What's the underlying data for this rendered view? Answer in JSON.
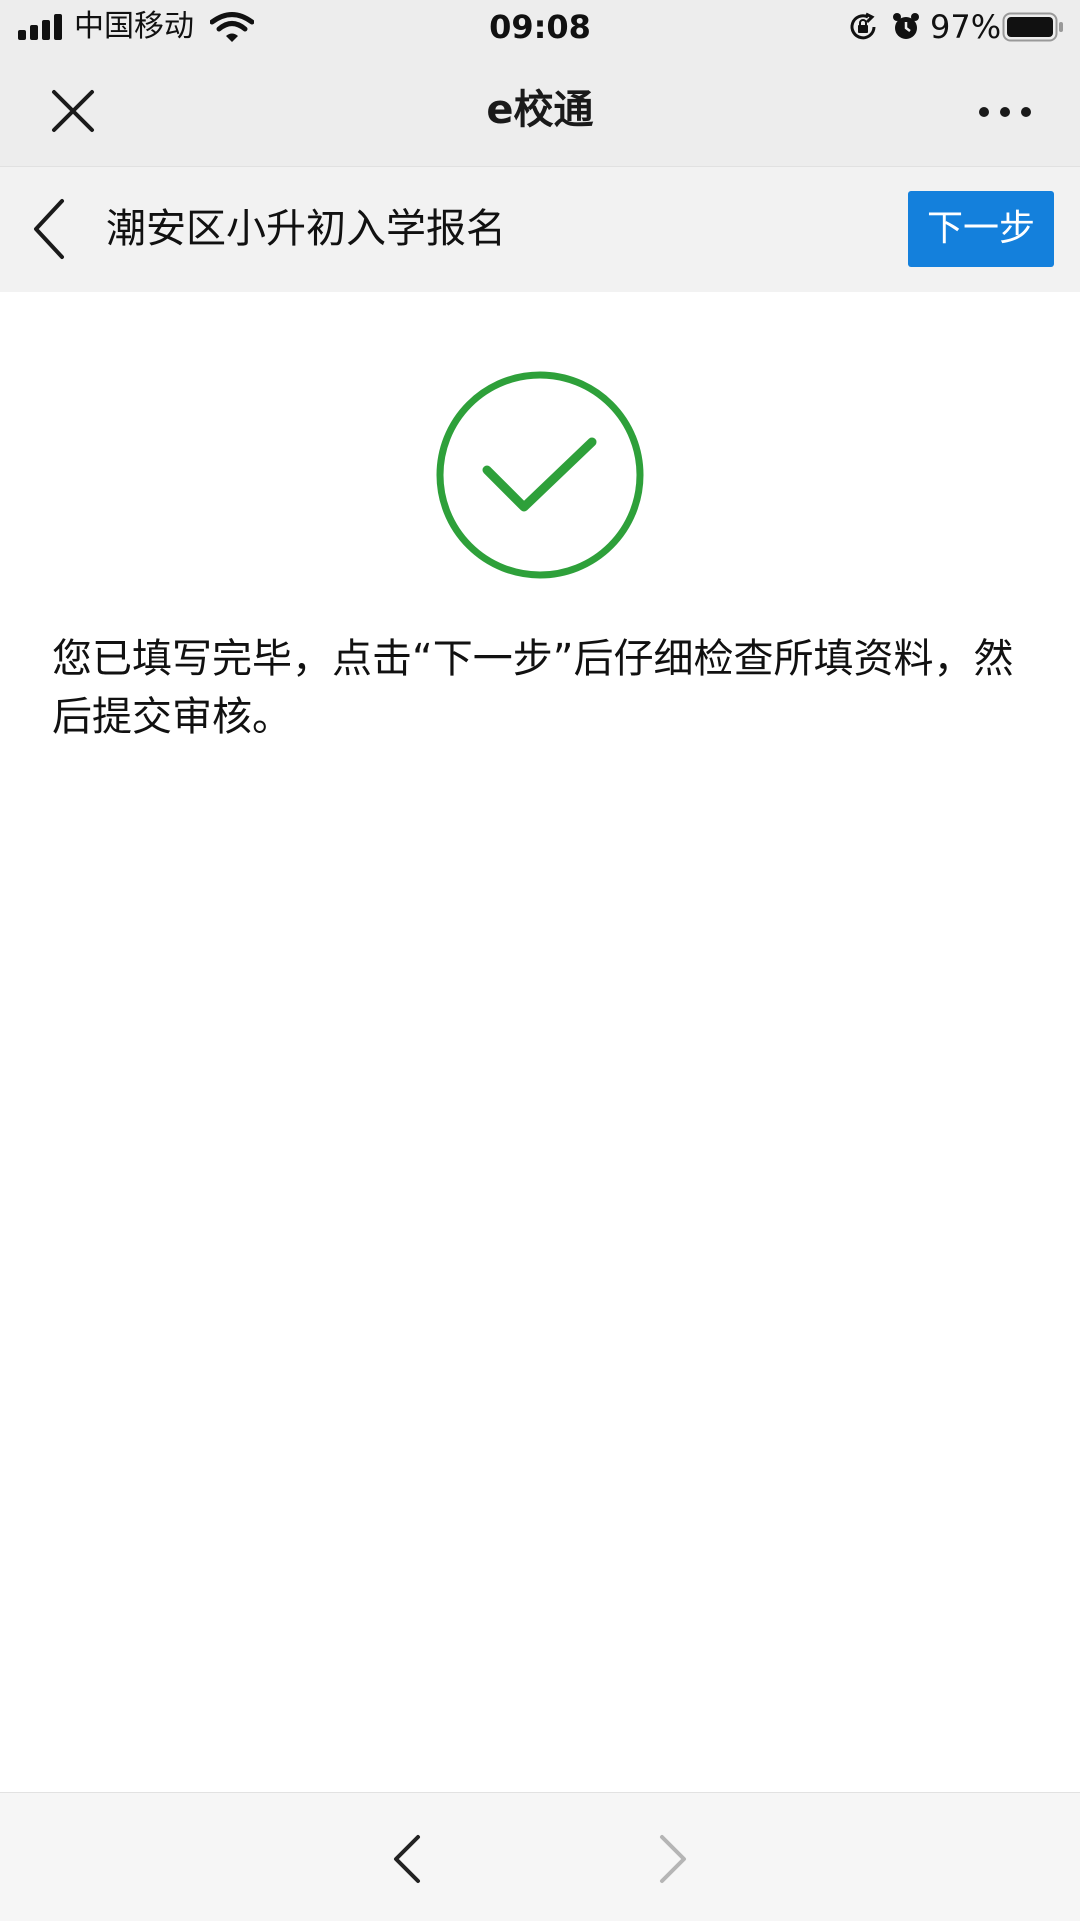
{
  "status_bar": {
    "carrier": "中国移动",
    "time": "09:08",
    "battery_percent": "97%",
    "icons": [
      "cellular-signal-icon",
      "wifi-icon",
      "rotation-lock-icon",
      "alarm-icon",
      "battery-icon"
    ]
  },
  "title_bar": {
    "app_name": "e校通",
    "left_icon": "close-icon",
    "right_icon": "more-icon"
  },
  "page_header": {
    "title": "潮安区小升初入学报名",
    "back_icon": "chevron-left-icon",
    "next_label": "下一步"
  },
  "content": {
    "status_icon": "check-circle-icon",
    "message": "您已填写完毕，点击“下一步”后仔细检查所填资料，然后提交审核。"
  },
  "bottom_bar": {
    "back_icon": "chevron-left-icon",
    "forward_icon": "chevron-right-icon",
    "forward_enabled": false
  },
  "colors": {
    "primary_button": "#1480dc",
    "success_green": "#2ea03a",
    "bar_background": "#ededed",
    "header_background": "#f2f2f2"
  }
}
